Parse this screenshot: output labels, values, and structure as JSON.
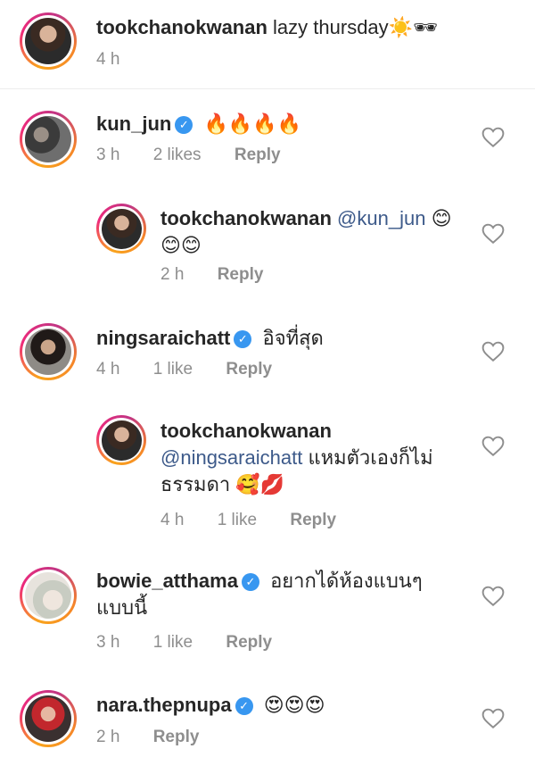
{
  "caption": {
    "username": "tookchanokwanan",
    "text": "lazy thursday",
    "emoji": "☀️🕶",
    "time": "4 h"
  },
  "comments": [
    {
      "username": "kun_jun",
      "text": "🔥🔥🔥🔥",
      "time": "3 h",
      "likes": "2 likes",
      "reply": "Reply"
    },
    {
      "username": "tookchanokwanan",
      "mention": "@kun_jun",
      "text": "😊",
      "text2": "😊😊",
      "time": "2 h",
      "reply": "Reply"
    },
    {
      "username": "ningsaraichatt",
      "text": "อิจที่สุด",
      "time": "4 h",
      "likes": "1 like",
      "reply": "Reply"
    },
    {
      "username": "tookchanokwanan",
      "mention": "@ningsaraichatt",
      "text": "แหมตัวเองก็ไม่",
      "text2": "ธรรมดา",
      "emoji": "🥰💋",
      "time": "4 h",
      "likes": "1 like",
      "reply": "Reply"
    },
    {
      "username": "bowie_atthama",
      "text": "อยากได้ห้องแบนๆ",
      "text2": "แบบนี้",
      "time": "3 h",
      "likes": "1 like",
      "reply": "Reply"
    },
    {
      "username": "nara.thepnupa",
      "text": "😍😍😍",
      "time": "2 h",
      "reply": "Reply"
    }
  ],
  "icons": {
    "heart": "heart-outline-icon",
    "verified": "verified-badge-icon"
  },
  "colors": {
    "text": "#262626",
    "meta": "#8e8e8e",
    "mention": "#3d5a8a",
    "verified": "#3897f0"
  }
}
